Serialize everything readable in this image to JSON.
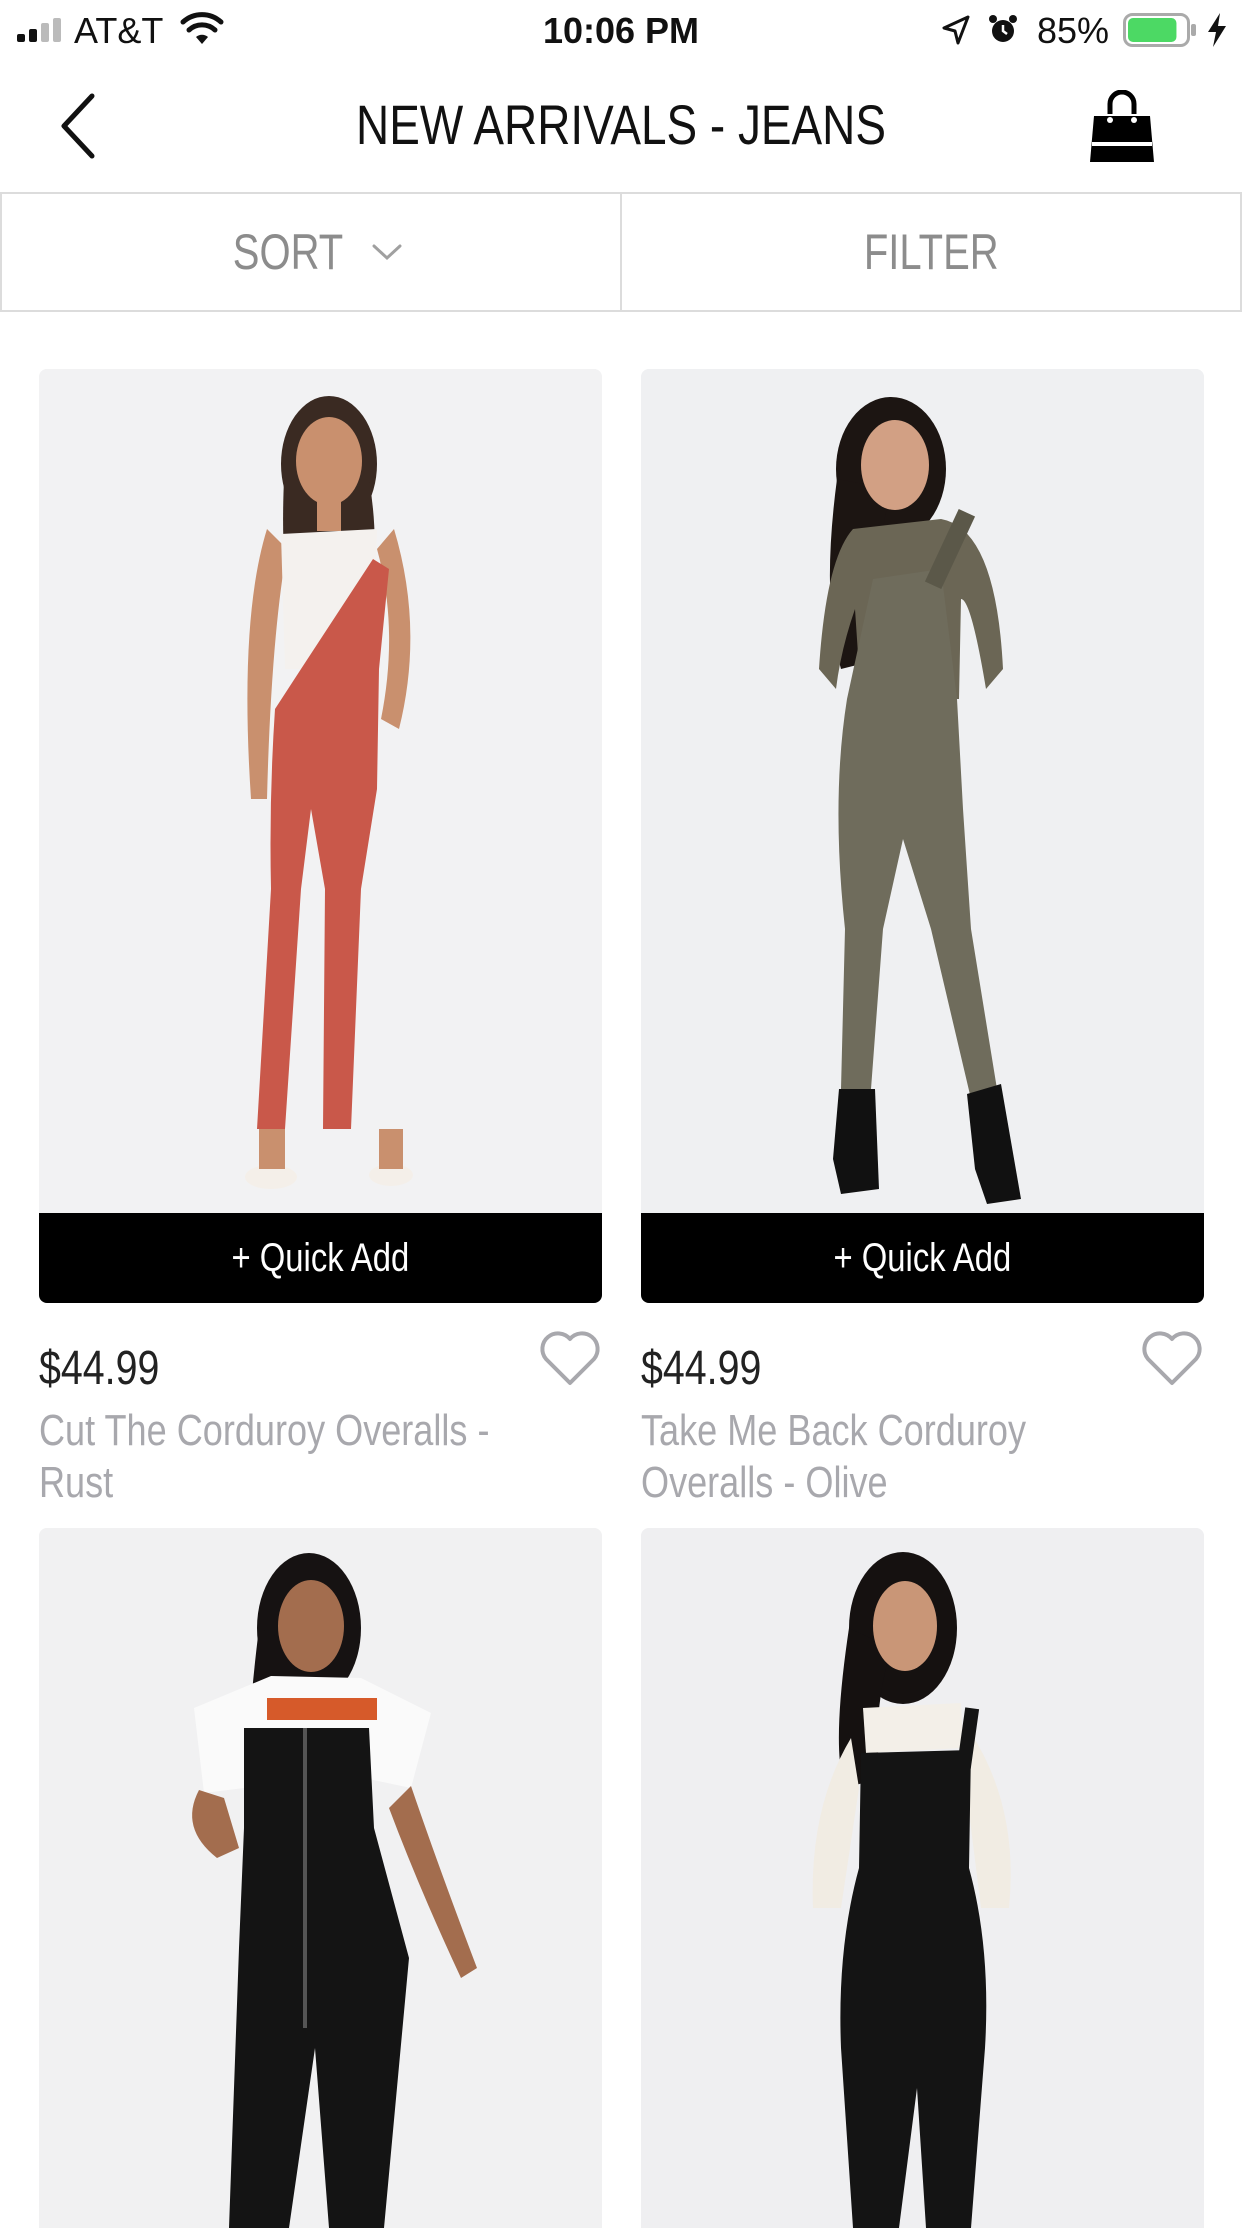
{
  "status_bar": {
    "carrier": "AT&T",
    "time": "10:06 PM",
    "battery_percent": "85%",
    "battery_level": 0.85,
    "battery_color": "#4cd964"
  },
  "header": {
    "title": "NEW ARRIVALS - JEANS",
    "back_icon": "chevron-left-icon",
    "bag_icon": "shopping-bag-icon"
  },
  "toolbar": {
    "sort_label": "SORT",
    "filter_label": "FILTER"
  },
  "products": [
    {
      "quick_add": "+ Quick Add",
      "price": "$44.99",
      "name": "Cut The Corduroy Overalls - Rust",
      "color": "#c9584a"
    },
    {
      "quick_add": "+ Quick Add",
      "price": "$44.99",
      "name": "Take Me Back Corduroy Overalls - Olive",
      "color": "#6f6c5c"
    },
    {
      "color": "#141414"
    },
    {
      "color": "#141414"
    }
  ]
}
